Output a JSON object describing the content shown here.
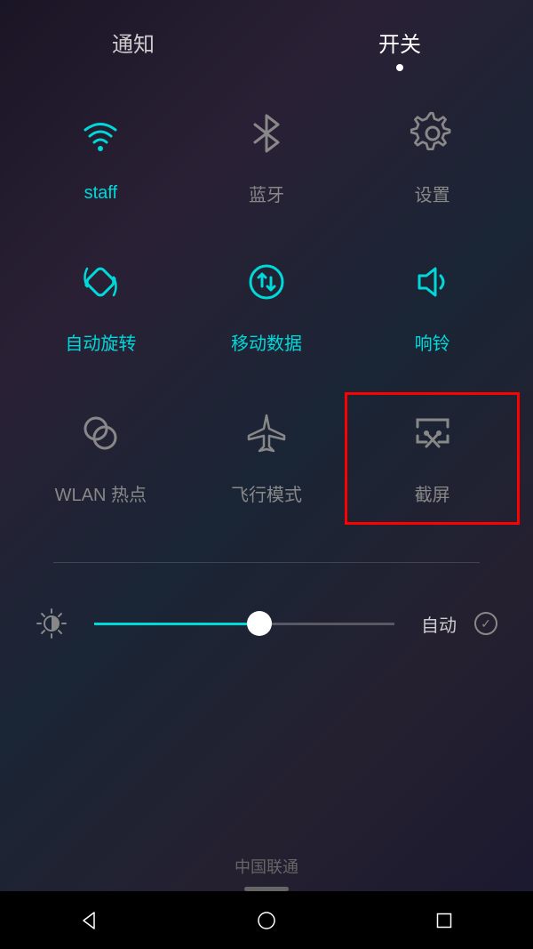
{
  "tabs": {
    "notifications": "通知",
    "toggles": "开关"
  },
  "tiles": [
    {
      "label": "staff",
      "icon": "wifi",
      "active": true
    },
    {
      "label": "蓝牙",
      "icon": "bluetooth",
      "active": false
    },
    {
      "label": "设置",
      "icon": "settings",
      "active": false
    },
    {
      "label": "自动旋转",
      "icon": "rotate",
      "active": true
    },
    {
      "label": "移动数据",
      "icon": "data",
      "active": true
    },
    {
      "label": "响铃",
      "icon": "sound",
      "active": true
    },
    {
      "label": "WLAN 热点",
      "icon": "hotspot",
      "active": false
    },
    {
      "label": "飞行模式",
      "icon": "airplane",
      "active": false
    },
    {
      "label": "截屏",
      "icon": "screenshot",
      "active": false,
      "highlighted": true
    }
  ],
  "brightness": {
    "auto_label": "自动",
    "value": 55,
    "auto_checked": true
  },
  "carrier": "中国联通",
  "colors": {
    "accent": "#00d9d9",
    "inactive": "#888888",
    "highlight": "#ff0000"
  }
}
